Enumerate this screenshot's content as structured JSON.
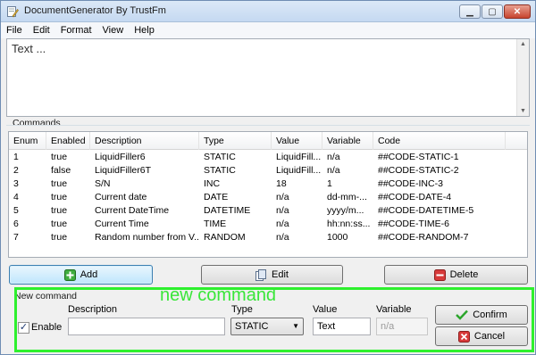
{
  "window": {
    "title": "DocumentGenerator By TrustFm",
    "controls": {
      "minimize": "▁",
      "maximize": "▢",
      "close": "✕"
    }
  },
  "menu": [
    "File",
    "Edit",
    "Format",
    "View",
    "Help"
  ],
  "editor": {
    "text": "Text ..."
  },
  "commands": {
    "label": "Commands",
    "columns": [
      "Enum",
      "Enabled",
      "Description",
      "Type",
      "Value",
      "Variable",
      "Code"
    ],
    "rows": [
      [
        "1",
        "true",
        "LiquidFiller6",
        "STATIC",
        "LiquidFill...",
        "n/a",
        "##CODE-STATIC-1"
      ],
      [
        "2",
        "false",
        "LiquidFiller6T",
        "STATIC",
        "LiquidFill...",
        "n/a",
        "##CODE-STATIC-2"
      ],
      [
        "3",
        "true",
        "S/N",
        "INC",
        "18",
        "1",
        "##CODE-INC-3"
      ],
      [
        "4",
        "true",
        "Current date",
        "DATE",
        "n/a",
        "dd-mm-...",
        "##CODE-DATE-4"
      ],
      [
        "5",
        "true",
        "Current DateTime",
        "DATETIME",
        "n/a",
        "yyyy/m...",
        "##CODE-DATETIME-5"
      ],
      [
        "6",
        "true",
        "Current Time",
        "TIME",
        "n/a",
        "hh:nn:ss...",
        "##CODE-TIME-6"
      ],
      [
        "7",
        "true",
        "Random number from V...",
        "RANDOM",
        "n/a",
        "1000",
        "##CODE-RANDOM-7"
      ]
    ]
  },
  "actions": {
    "add": "Add",
    "edit": "Edit",
    "delete": "Delete"
  },
  "new_command": {
    "group_label": "New command",
    "overlay_caption": "new command",
    "enable_label": "Enable",
    "enable_checked": "✓",
    "description_label": "Description",
    "description_value": "",
    "type_label": "Type",
    "type_value": "STATIC",
    "value_label": "Value",
    "value_value": "Text",
    "variable_label": "Variable",
    "variable_value": "n/a",
    "confirm_label": "Confirm",
    "cancel_label": "Cancel"
  },
  "colors": {
    "highlight_frame": "#2ef02e",
    "overlay_text": "#39e639"
  }
}
